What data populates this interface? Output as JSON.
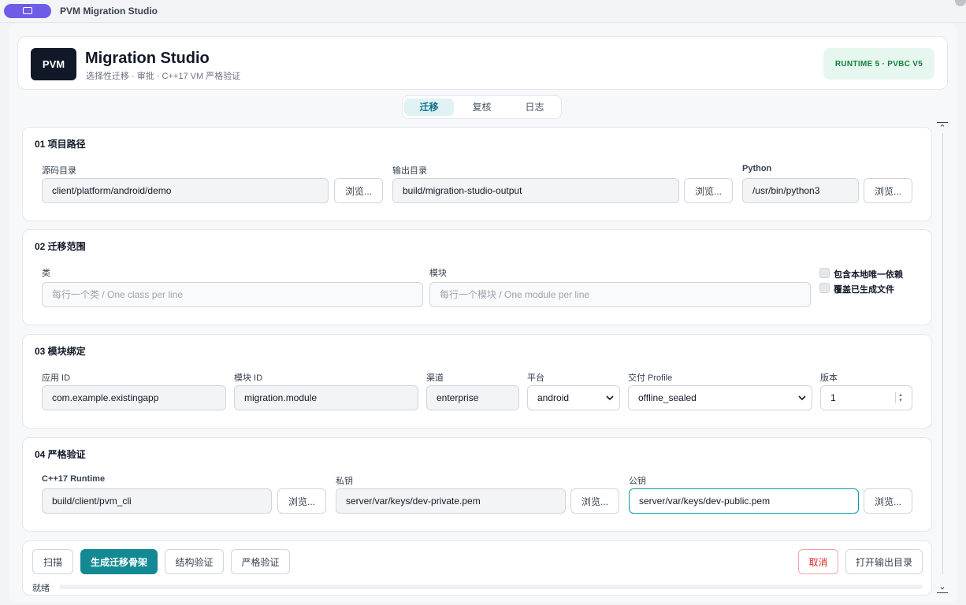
{
  "window": {
    "title": "PVM Migration Studio"
  },
  "header": {
    "logo": "PVM",
    "title": "Migration Studio",
    "subtitle": "选择性迁移 · 审批 · C++17 VM 严格验证",
    "badge": "RUNTIME 5 · PVBC V5"
  },
  "tabs": [
    {
      "label": "迁移",
      "active": true
    },
    {
      "label": "复核",
      "active": false
    },
    {
      "label": "日志",
      "active": false
    }
  ],
  "project_paths": {
    "title": "01  项目路径",
    "source_label": "源码目录",
    "source_value": "client/platform/android/demo",
    "output_label": "输出目录",
    "output_value": "build/migration-studio-output",
    "python_label": "Python",
    "python_value": "/usr/bin/python3",
    "browse_label": "浏览..."
  },
  "scope": {
    "title": "02  迁移范围",
    "class_label": "类",
    "class_placeholder": "每行一个类 / One class per line",
    "module_label": "模块",
    "module_placeholder": "每行一个模块 / One module per line",
    "include_deps_label": "包含本地唯一依赖",
    "overwrite_label": "覆盖已生成文件",
    "include_deps_checked": false,
    "overwrite_checked": false
  },
  "binding": {
    "title": "03  模块绑定",
    "app_id_label": "应用 ID",
    "app_id_value": "com.example.existingapp",
    "module_id_label": "模块 ID",
    "module_id_value": "migration.module",
    "channel_label": "渠道",
    "channel_value": "enterprise",
    "platform_label": "平台",
    "platform_value": "android",
    "profile_label": "交付 Profile",
    "profile_value": "offline_sealed",
    "version_label": "版本",
    "version_value": "1"
  },
  "strict": {
    "title": "04  严格验证",
    "runtime_label": "C++17 Runtime",
    "runtime_value": "build/client/pvm_cli",
    "private_label": "私钥",
    "private_value": "server/var/keys/dev-private.pem",
    "public_label": "公钥",
    "public_value": "server/var/keys/dev-public.pem",
    "browse_label": "浏览..."
  },
  "actions": {
    "scan": "扫描",
    "generate": "生成迁移骨架",
    "structure_verify": "结构验证",
    "strict_verify": "严格验证",
    "cancel": "取消",
    "open_output": "打开输出目录",
    "status": "就绪",
    "progress": 0
  }
}
